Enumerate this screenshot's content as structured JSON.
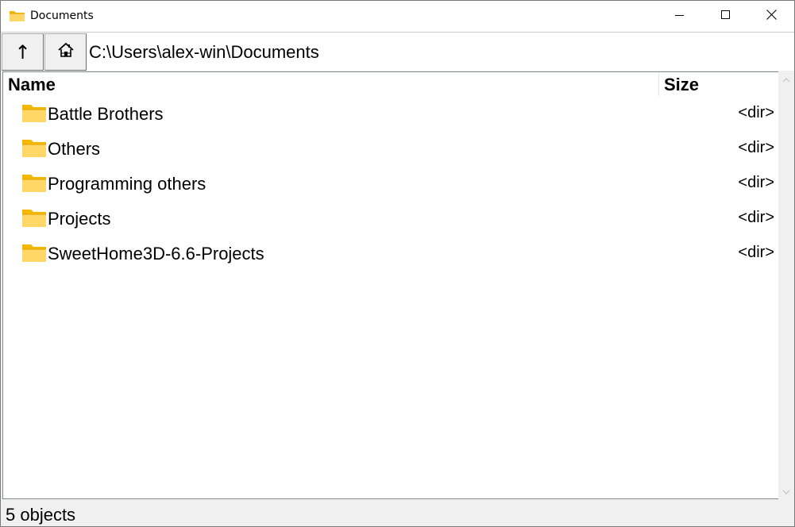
{
  "window": {
    "title": "Documents",
    "title_icon": "folder-icon"
  },
  "titlebar": {
    "minimize_icon": "minimize-icon",
    "maximize_icon": "maximize-icon",
    "close_icon": "close-icon"
  },
  "toolbar": {
    "up_label": "↑",
    "up_icon": "up-arrow-icon",
    "home_icon": "home-icon",
    "path": "C:\\Users\\alex-win\\Documents"
  },
  "list": {
    "columns": [
      "Name",
      "Size"
    ],
    "items": [
      {
        "name": "Battle Brothers",
        "size": "<dir>",
        "icon": "folder-icon"
      },
      {
        "name": "Others",
        "size": "<dir>",
        "icon": "folder-icon"
      },
      {
        "name": "Programming others",
        "size": "<dir>",
        "icon": "folder-icon"
      },
      {
        "name": "Projects",
        "size": "<dir>",
        "icon": "folder-icon"
      },
      {
        "name": "SweetHome3D-6.6-Projects",
        "size": "<dir>",
        "icon": "folder-icon"
      }
    ]
  },
  "status": {
    "text": "5 objects"
  },
  "colors": {
    "folder_light": "#ffd766",
    "folder_dark": "#f5b800",
    "folder_edge": "#e0a200",
    "border": "#828790"
  }
}
